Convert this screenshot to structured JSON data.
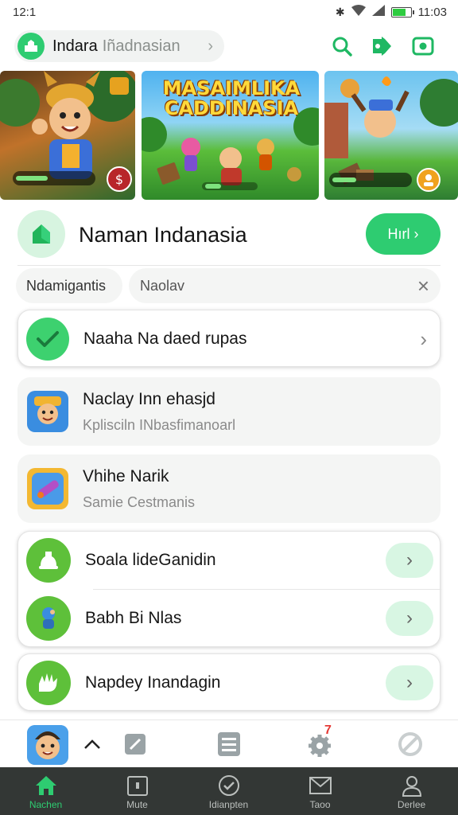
{
  "status_bar": {
    "time": "12:1",
    "clock": "11:03"
  },
  "header": {
    "search_primary": "Indara",
    "search_secondary": "Iñadnasian",
    "icons": [
      "search-icon",
      "game-controller-icon",
      "camera-icon"
    ]
  },
  "banners": [
    {
      "name": "hero-banner-1"
    },
    {
      "name": "hero-banner-2",
      "title": "MASAIMLIKA CADDINASIA"
    },
    {
      "name": "hero-banner-3"
    }
  ],
  "app": {
    "title": "Naman Indanasia",
    "cta_label": "Hırl ›"
  },
  "filters": {
    "chip_label": "Ndamigantis",
    "search_value": "Naolav"
  },
  "list": {
    "featured": {
      "label": "Naaha Na daed rupas"
    },
    "items": [
      {
        "title": "Naclay Inn ehasjd",
        "subtitle": "Kplisciln INbasfimanoarl"
      },
      {
        "title": "Vhihe Narik",
        "subtitle": "Samie Cestmanis"
      }
    ],
    "group_1": [
      {
        "label": "Soala lideGanidin"
      },
      {
        "label": "Babh Bi Nlas"
      }
    ],
    "group_2": [
      {
        "label": "Napdey Inandagin"
      }
    ]
  },
  "toolbar": {
    "badge": "7"
  },
  "nav": {
    "items": [
      {
        "label": "Nachen",
        "icon": "home-icon",
        "active": true
      },
      {
        "label": "Mute",
        "icon": "calendar-icon",
        "active": false
      },
      {
        "label": "Idianpten",
        "icon": "check-circle-icon",
        "active": false
      },
      {
        "label": "Taoo",
        "icon": "mail-icon",
        "active": false
      },
      {
        "label": "Derlee",
        "icon": "person-icon",
        "active": false
      }
    ]
  },
  "colors": {
    "accent": "#2ecc71",
    "nav_bg": "#333735"
  }
}
